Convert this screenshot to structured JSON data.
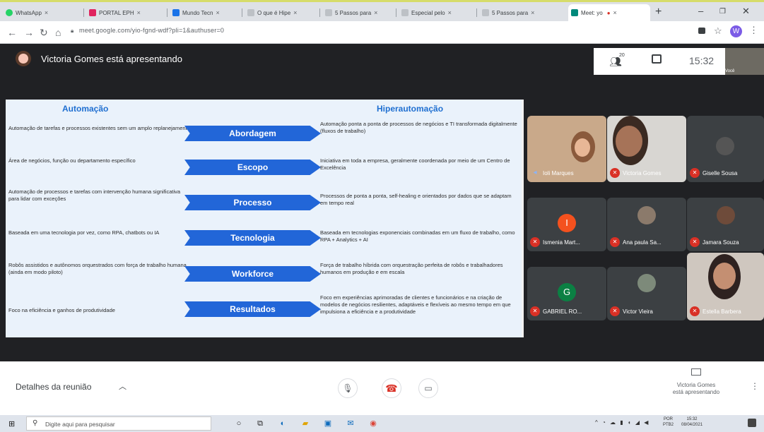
{
  "browser": {
    "tabs": [
      {
        "label": "WhatsApp",
        "color": "#25d366"
      },
      {
        "label": "PORTAL EPH",
        "color": "#e0245e"
      },
      {
        "label": "Mundo Tecn",
        "color": "#1a73e8"
      },
      {
        "label": "O que é Hipe",
        "color": "#9aa0a6"
      },
      {
        "label": "5 Passos para",
        "color": "#9aa0a6"
      },
      {
        "label": "Especial pelo",
        "color": "#9aa0a6"
      },
      {
        "label": "5 Passos para",
        "color": "#9aa0a6"
      },
      {
        "label": "Meet: yo",
        "color": "#00897b"
      }
    ],
    "url": "meet.google.com/yio-fgnd-wdf?pli=1&authuser=0",
    "profile_initial": "W"
  },
  "meet": {
    "presenter_text": "Victoria Gomes está apresentando",
    "people_count": "20",
    "clock": "15:32",
    "self_label": "Você"
  },
  "slide": {
    "left_header": "Automação",
    "right_header": "Hiperautomação",
    "rows": [
      {
        "left": "Automação de tarefas e processos existentes sem um amplo replanejamento",
        "label": "Abordagem",
        "right": "Automação ponta a ponta de processos de negócios e TI transformada digitalmente (fluxos de trabalho)"
      },
      {
        "left": "Área de negócios, função ou departamento específico",
        "label": "Escopo",
        "right": "Iniciativa em toda a empresa, geralmente coordenada por meio de um Centro de Excelência"
      },
      {
        "left": "Automação de processos e tarefas com intervenção humana significativa para lidar com exceções",
        "label": "Processo",
        "right": "Processos de ponta a ponta, self-healing e orientados por dados que se adaptam em tempo real"
      },
      {
        "left": "Baseada em uma tecnologia por vez, como RPA, chatbots ou IA",
        "label": "Tecnologia",
        "right": "Baseada em tecnologias exponenciais combinadas em um fluxo de trabalho, como RPA + Analytics + AI"
      },
      {
        "left": "Robôs assistidos e autônomos orquestrados com força de trabalho humana (ainda em modo piloto)",
        "label": "Workforce",
        "right": "Força de trabalho híbrida com orquestração perfeita de robôs e trabalhadores humanos em produção e em escala"
      },
      {
        "left": "Foco na eficiência e ganhos de produtividade",
        "label": "Resultados",
        "right": "Foco em experiências aprimoradas de clientes e funcionários e na criação de modelos de negócios resilientes, adaptáveis e flexíveis ao mesmo tempo em que impulsiona a eficiência e a produtividade"
      }
    ]
  },
  "participants": [
    {
      "name": "Ioli Marques",
      "muted": false,
      "kind": "video"
    },
    {
      "name": "Victoria Gomes",
      "muted": true,
      "kind": "video"
    },
    {
      "name": "Giselle Sousa",
      "muted": true,
      "kind": "photo"
    },
    {
      "name": "Ismenia Mart...",
      "muted": true,
      "kind": "initial",
      "initial": "I",
      "color": "#f4511e"
    },
    {
      "name": "Ana paula Sa...",
      "muted": true,
      "kind": "photo"
    },
    {
      "name": "Jamara Souza",
      "muted": true,
      "kind": "photo"
    },
    {
      "name": "GABRIEL RO...",
      "muted": true,
      "kind": "initial",
      "initial": "G",
      "color": "#0b8043"
    },
    {
      "name": "Victor Vieira",
      "muted": true,
      "kind": "photo"
    },
    {
      "name": "Estella Barbera",
      "muted": true,
      "kind": "video"
    }
  ],
  "bottom": {
    "details_label": "Detalhes da reunião",
    "presenting_line1": "Victoria Gomes",
    "presenting_line2": "está apresentando"
  },
  "taskbar": {
    "search_placeholder": "Digite aqui para pesquisar",
    "lang": "POR",
    "lang2": "PTB2",
    "time": "15:32",
    "date": "08/04/2021"
  }
}
